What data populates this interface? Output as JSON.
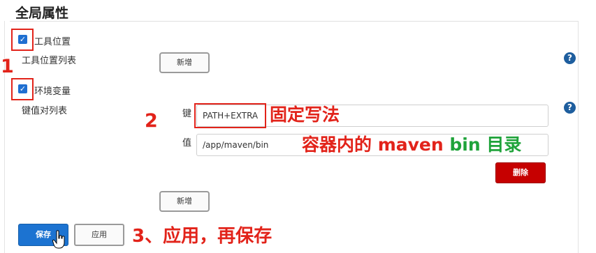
{
  "section_title": "全局属性",
  "tool_location": {
    "checkbox_checked": true,
    "label": "工具位置",
    "list_label": "工具位置列表",
    "add_button": "新增",
    "help_icon": "?"
  },
  "env_vars": {
    "checkbox_checked": true,
    "label": "环境变量",
    "list_label": "键值对列表",
    "key_label": "键",
    "key_value": "PATH+EXTRA",
    "value_label": "值",
    "value_value": "/app/maven/bin",
    "delete_button": "删除",
    "add_button": "新增",
    "help_icon": "?"
  },
  "footer": {
    "save_button": "保存",
    "apply_button": "应用"
  },
  "annotations": {
    "step1": "1",
    "step2": "2",
    "key_note": "固定写法",
    "value_note_a": "容器内的 maven ",
    "value_note_b": "bin",
    "value_note_c": " 目录",
    "step3": "3、应用，再保存"
  },
  "colors": {
    "annotation_red": "#e2231a",
    "annotation_green": "#1fa33a",
    "primary_blue": "#1c73d1",
    "danger_red": "#c60000"
  }
}
